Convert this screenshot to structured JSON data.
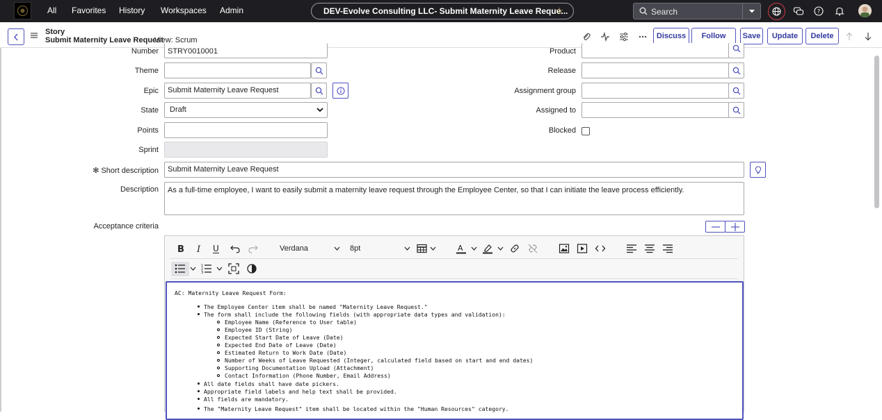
{
  "topbar": {
    "nav": [
      "All",
      "Favorites",
      "History",
      "Workspaces",
      "Admin"
    ],
    "record_title": "DEV-Evolve Consulting LLC- Submit Maternity Leave Reque...",
    "search_placeholder": "Search"
  },
  "form_header": {
    "record_type": "Story",
    "record_name": "Submit Maternity Leave Request",
    "view_label": "View: Scrum",
    "buttons": {
      "discuss": "Discuss",
      "follow": "Follow",
      "save": "Save",
      "update": "Update",
      "delete": "Delete"
    }
  },
  "fields": {
    "number": {
      "label": "Number",
      "value": "STRY0010001"
    },
    "product": {
      "label": "Product",
      "value": ""
    },
    "theme": {
      "label": "Theme",
      "value": ""
    },
    "release": {
      "label": "Release",
      "value": ""
    },
    "epic": {
      "label": "Epic",
      "value": "Submit Maternity Leave Request"
    },
    "assignment_group": {
      "label": "Assignment group",
      "value": ""
    },
    "state": {
      "label": "State",
      "value": "Draft"
    },
    "assigned_to": {
      "label": "Assigned to",
      "value": ""
    },
    "points": {
      "label": "Points",
      "value": ""
    },
    "blocked": {
      "label": "Blocked",
      "checked": false
    },
    "sprint": {
      "label": "Sprint",
      "value": ""
    },
    "short_description": {
      "label": "Short description",
      "required_marker": "✻",
      "value": "Submit Maternity Leave Request"
    },
    "description": {
      "label": "Description",
      "value": "As a full-time employee, I want to easily submit a maternity leave request through the Employee Center, so that I can initiate the leave process efficiently."
    },
    "acceptance_criteria": {
      "label": "Acceptance criteria"
    }
  },
  "editor": {
    "font_family": "Verdana",
    "font_size": "8pt",
    "content": {
      "heading": "AC: Maternity Leave Request Form:",
      "items": [
        "The Employee Center item shall be named \"Maternity Leave Request.\"",
        "The form shall include the following fields (with appropriate data types and validation):"
      ],
      "subitems": [
        "Employee Name (Reference to User table)",
        "Employee ID (String)",
        "Expected Start Date of Leave (Date)",
        "Expected End Date of Leave (Date)",
        "Estimated Return to Work Date (Date)",
        "Number of Weeks of Leave Requested (Integer, calculated field based on start and end dates)",
        "Supporting Documentation Upload (Attachment)",
        "Contact Information (Phone Number, Email Address)"
      ],
      "items_after": [
        "All date fields shall have date pickers.",
        "Appropriate field labels and help text shall be provided.",
        "All fields are mandatory.",
        "The \"Maternity Leave Request\" item shall be located within the \"Human Resources\" category."
      ]
    }
  },
  "colors": {
    "topbar": "#1e1e22",
    "accent": "#4f52bd",
    "star": "#d6b24a",
    "globe_ring": "#d23c4a"
  }
}
